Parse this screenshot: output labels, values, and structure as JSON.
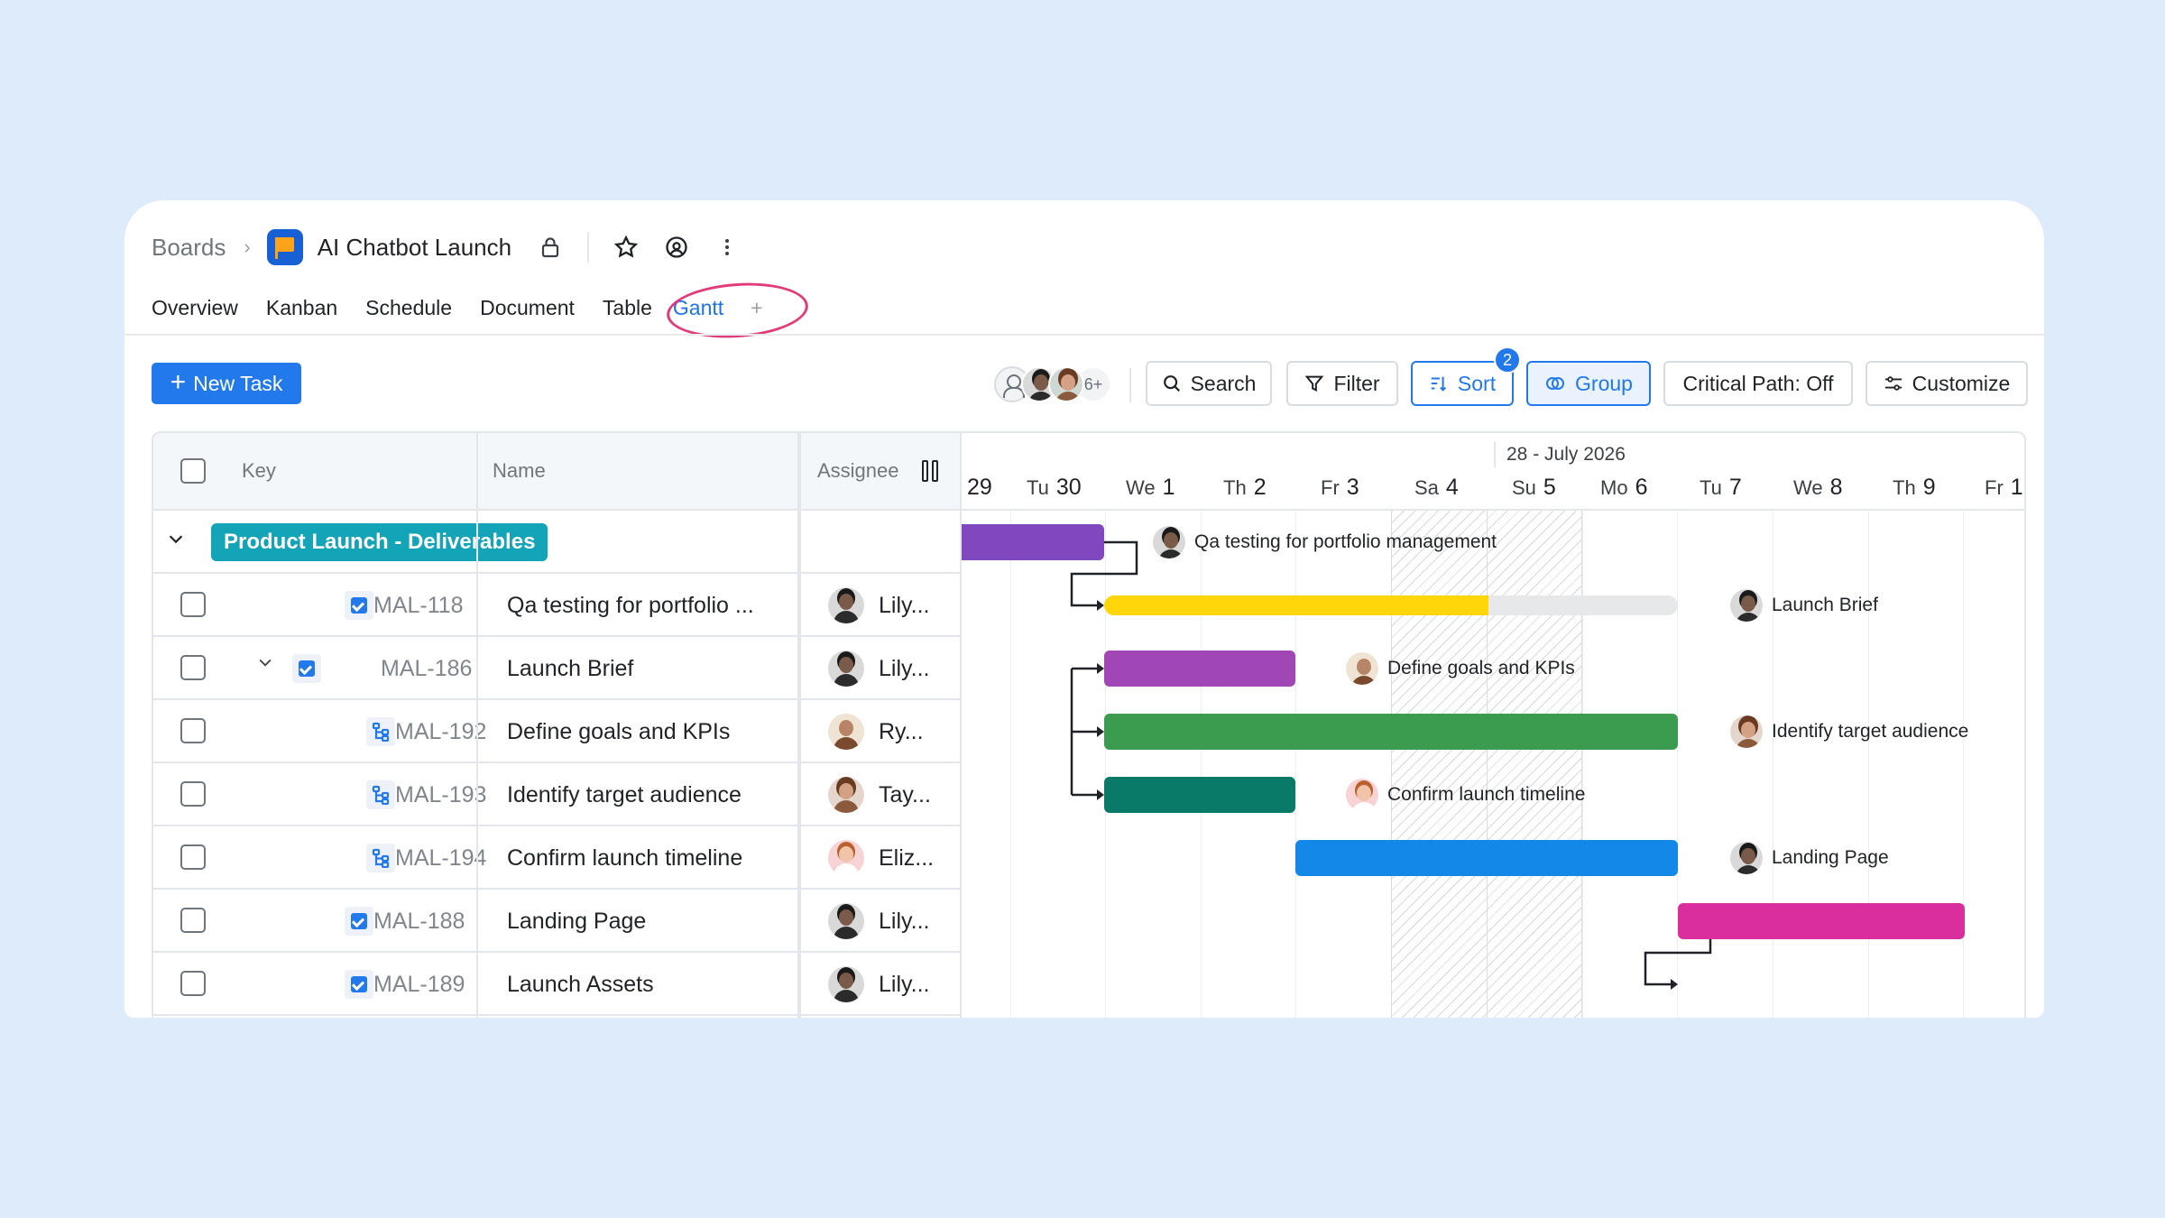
{
  "breadcrumb": {
    "root": "Boards",
    "board_title": "AI Chatbot Launch"
  },
  "tabs": [
    "Overview",
    "Kanban",
    "Schedule",
    "Document",
    "Table",
    "Gantt"
  ],
  "active_tab": "Gantt",
  "toolbar": {
    "new_task": "New Task",
    "members_more": "6+",
    "search": "Search",
    "filter": "Filter",
    "sort": "Sort",
    "sort_count": "2",
    "group": "Group",
    "critical_path": "Critical Path: Off",
    "customize": "Customize"
  },
  "columns": {
    "key": "Key",
    "name": "Name",
    "assignee": "Assignee"
  },
  "group": {
    "label": "Product Launch - Deliverables",
    "color": "#14a4b7"
  },
  "tasks": [
    {
      "key": "MAL-118",
      "name": "Qa testing for portfolio ...",
      "assignee": "Lily...",
      "bar_label": "Qa testing for portfolio management",
      "color": "#8147be"
    },
    {
      "key": "MAL-186",
      "name": "Launch Brief",
      "assignee": "Lily...",
      "bar_label": "Launch Brief",
      "color": "#ffd60a",
      "progress": 0.67
    },
    {
      "key": "MAL-192",
      "name": "Define goals and KPIs",
      "assignee": "Ry...",
      "bar_label": "Define goals and KPIs",
      "color": "#a147b5"
    },
    {
      "key": "MAL-193",
      "name": "Identify target audience",
      "assignee": "Tay...",
      "bar_label": "Identify target audience",
      "color": "#3b9c4f"
    },
    {
      "key": "MAL-194",
      "name": "Confirm launch timeline",
      "assignee": "Eliz...",
      "bar_label": "Confirm launch timeline",
      "color": "#0a7a68"
    },
    {
      "key": "MAL-188",
      "name": "Landing Page",
      "assignee": "Lily...",
      "bar_label": "Landing Page",
      "color": "#1388e9"
    },
    {
      "key": "MAL-189",
      "name": "Launch Assets",
      "assignee": "Lily...",
      "bar_label": "",
      "color": "#d92f9e"
    }
  ],
  "timeline": {
    "month_label": "28 - July 2026",
    "days": [
      {
        "dow": "",
        "num": "29"
      },
      {
        "dow": "Tu",
        "num": "30"
      },
      {
        "dow": "We",
        "num": "1"
      },
      {
        "dow": "Th",
        "num": "2"
      },
      {
        "dow": "Fr",
        "num": "3"
      },
      {
        "dow": "Sa",
        "num": "4"
      },
      {
        "dow": "Su",
        "num": "5"
      },
      {
        "dow": "Mo",
        "num": "6"
      },
      {
        "dow": "Tu",
        "num": "7"
      },
      {
        "dow": "We",
        "num": "8"
      },
      {
        "dow": "Th",
        "num": "9"
      },
      {
        "dow": "Fr",
        "num": "1"
      }
    ]
  },
  "accent_color": "#2179ec"
}
